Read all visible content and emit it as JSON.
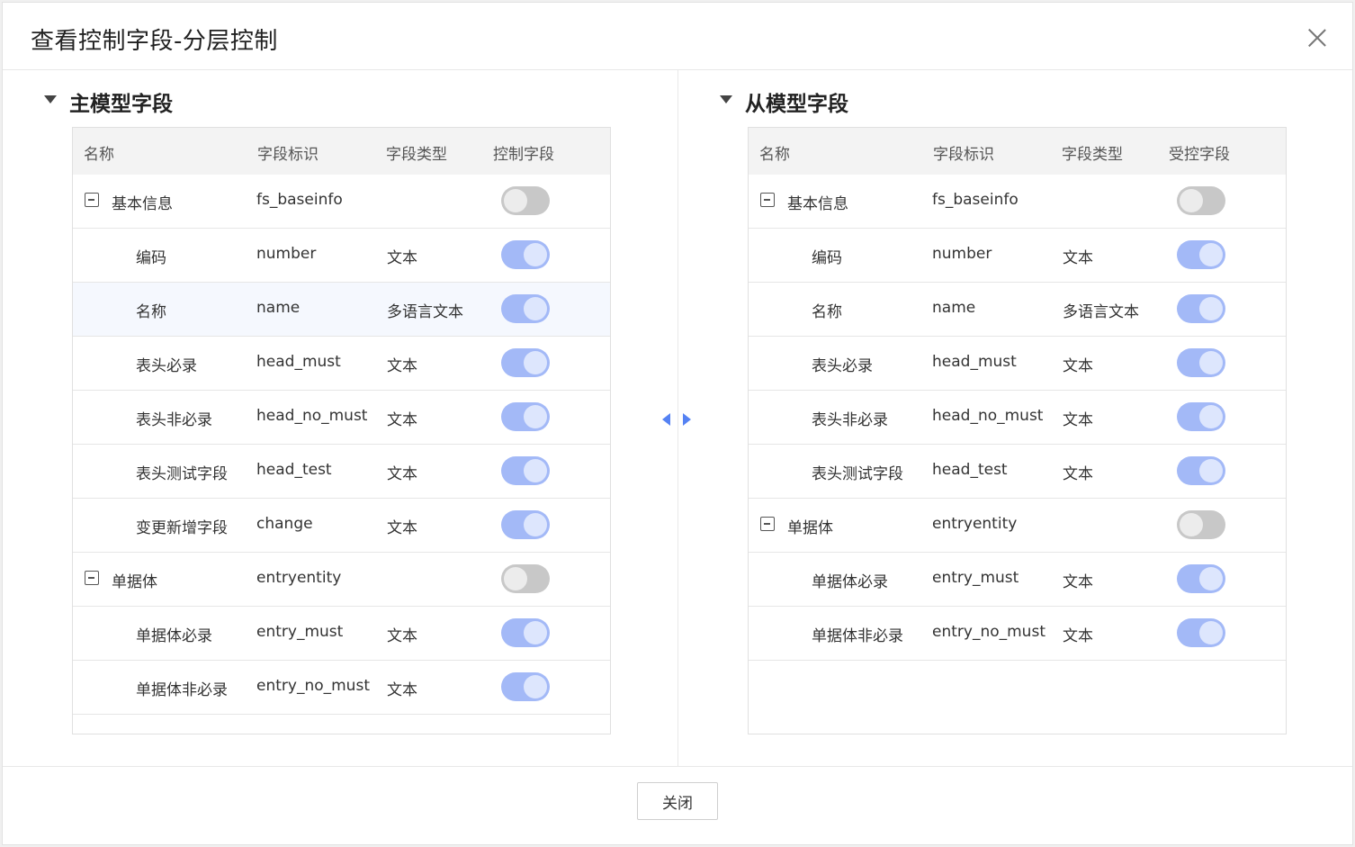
{
  "dialog": {
    "title": "查看控制字段-分层控制",
    "close_label": "关闭"
  },
  "left_panel": {
    "title": "主模型字段",
    "columns": [
      "名称",
      "字段标识",
      "字段类型",
      "控制字段"
    ],
    "rows": [
      {
        "name": "基本信息",
        "key": "fs_baseinfo",
        "type": "",
        "toggle": "off",
        "group": true
      },
      {
        "name": "编码",
        "key": "number",
        "type": "文本",
        "toggle": "on",
        "group": false
      },
      {
        "name": "名称",
        "key": "name",
        "type": "多语言文本",
        "toggle": "on",
        "group": false,
        "highlight": true
      },
      {
        "name": "表头必录",
        "key": "head_must",
        "type": "文本",
        "toggle": "on",
        "group": false
      },
      {
        "name": "表头非必录",
        "key": "head_no_must",
        "type": "文本",
        "toggle": "on",
        "group": false
      },
      {
        "name": "表头测试字段",
        "key": "head_test",
        "type": "文本",
        "toggle": "on",
        "group": false
      },
      {
        "name": "变更新增字段",
        "key": "change",
        "type": "文本",
        "toggle": "on",
        "group": false
      },
      {
        "name": "单据体",
        "key": "entryentity",
        "type": "",
        "toggle": "off",
        "group": true
      },
      {
        "name": "单据体必录",
        "key": "entry_must",
        "type": "文本",
        "toggle": "on",
        "group": false
      },
      {
        "name": "单据体非必录",
        "key": "entry_no_must",
        "type": "文本",
        "toggle": "on",
        "group": false
      }
    ]
  },
  "right_panel": {
    "title": "从模型字段",
    "columns": [
      "名称",
      "字段标识",
      "字段类型",
      "受控字段"
    ],
    "rows": [
      {
        "name": "基本信息",
        "key": "fs_baseinfo",
        "type": "",
        "toggle": "off",
        "group": true
      },
      {
        "name": "编码",
        "key": "number",
        "type": "文本",
        "toggle": "on",
        "group": false
      },
      {
        "name": "名称",
        "key": "name",
        "type": "多语言文本",
        "toggle": "on",
        "group": false
      },
      {
        "name": "表头必录",
        "key": "head_must",
        "type": "文本",
        "toggle": "on",
        "group": false
      },
      {
        "name": "表头非必录",
        "key": "head_no_must",
        "type": "文本",
        "toggle": "on",
        "group": false
      },
      {
        "name": "表头测试字段",
        "key": "head_test",
        "type": "文本",
        "toggle": "on",
        "group": false
      },
      {
        "name": "单据体",
        "key": "entryentity",
        "type": "",
        "toggle": "off",
        "group": true
      },
      {
        "name": "单据体必录",
        "key": "entry_must",
        "type": "文本",
        "toggle": "on",
        "group": false
      },
      {
        "name": "单据体非必录",
        "key": "entry_no_must",
        "type": "文本",
        "toggle": "on",
        "group": false
      }
    ]
  },
  "colors": {
    "toggle_on": "#a3b9f7",
    "toggle_off": "#c8c8c8",
    "accent_arrow": "#5582f3"
  }
}
